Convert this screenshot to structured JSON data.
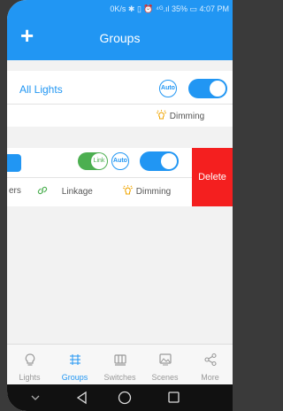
{
  "status_bar": {
    "text": "0K/s ✱ ▯ ⏰ ⁴ᴳ.ıl 35% ▭ 4:07 PM"
  },
  "header": {
    "add_symbol": "+",
    "title": "Groups"
  },
  "group1": {
    "name": "All Lights",
    "auto_label": "Auto",
    "dimming_label": "Dimming"
  },
  "group2": {
    "link_label": "Link",
    "auto_label": "Auto",
    "members_label": "ers",
    "linkage_label": "Linkage",
    "dimming_label": "Dimming",
    "delete_label": "Delete"
  },
  "tabs": [
    {
      "label": "Lights",
      "icon": "bulb-icon"
    },
    {
      "label": "Groups",
      "icon": "groups-icon"
    },
    {
      "label": "Switches",
      "icon": "switch-icon"
    },
    {
      "label": "Scenes",
      "icon": "scene-icon"
    },
    {
      "label": "More",
      "icon": "share-icon"
    }
  ],
  "active_tab": "Groups",
  "colors": {
    "primary": "#2196f3",
    "link_green": "#4caf50",
    "delete_red": "#f41f1f"
  }
}
